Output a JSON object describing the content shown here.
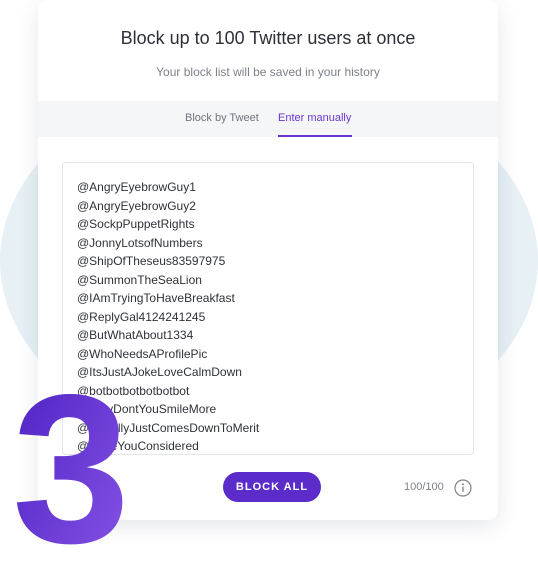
{
  "header": {
    "title": "Block up to 100 Twitter users at once",
    "subtitle": "Your block list will be saved in your history"
  },
  "tabs": [
    {
      "label": "Block by Tweet",
      "active": false
    },
    {
      "label": "Enter manually",
      "active": true
    }
  ],
  "users": [
    "@AngryEyebrowGuy1",
    "@AngryEyebrowGuy2",
    "@SockpPuppetRights",
    "@JonnyLotsofNumbers",
    "@ShipOfTheseus83597975",
    "@SummonTheSeaLion",
    "@IAmTryingToHaveBreakfast",
    "@ReplyGal4124241245",
    "@ButWhatAbout1334",
    "@WhoNeedsAProfilePic",
    "@ItsJustAJokeLoveCalmDown",
    "@botbotbotbotbotbot",
    "@WhyDontYouSmileMore",
    "@ItReallyJustComesDownToMerit",
    "@HaveYouConsidered"
  ],
  "actions": {
    "block_all_label": "BLOCK ALL"
  },
  "counter": {
    "text": "100/100"
  },
  "decoration": {
    "step_number": "3"
  },
  "colors": {
    "accent": "#5b2cc9",
    "tab_active": "#6a36d2",
    "blob": "#e6f0f5",
    "step_gradient_start": "#4a1fc1",
    "step_gradient_end": "#8a56e8"
  },
  "icons": {
    "info": "info-circle-icon"
  }
}
